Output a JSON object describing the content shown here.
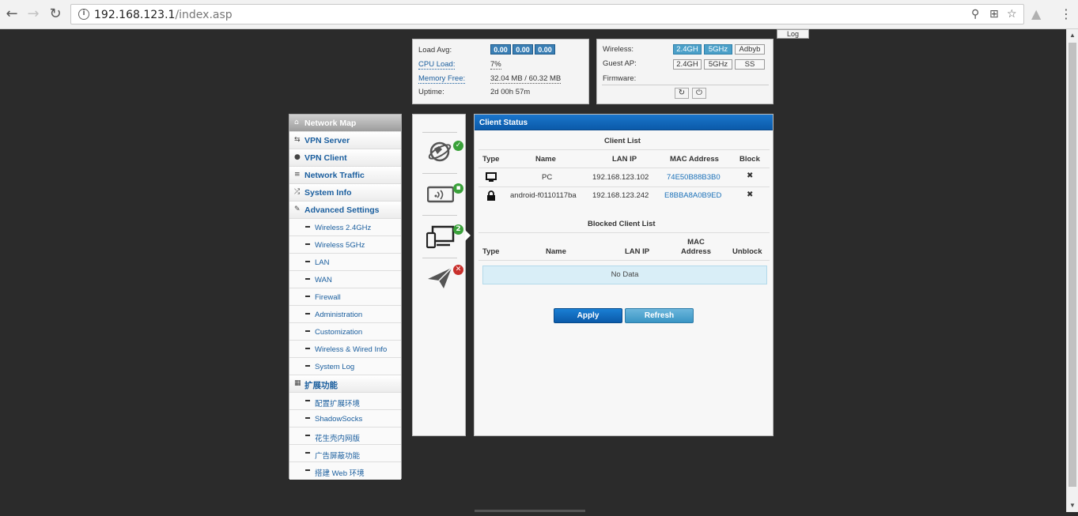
{
  "browser": {
    "url_host": "192.168.123.1",
    "url_path": "/index.asp"
  },
  "log_label": "Log",
  "status": {
    "load_avg_label": "Load Avg:",
    "load_values": [
      "0.00",
      "0.00",
      "0.00"
    ],
    "cpu_label": "CPU Load:",
    "cpu_value": "7%",
    "mem_label": "Memory Free:",
    "mem_value": "32.04 MB / 60.32 MB",
    "uptime_label": "Uptime:",
    "uptime_value": "2d 00h 57m"
  },
  "wireless": {
    "wireless_label": "Wireless:",
    "wireless_buttons": [
      "2.4GH",
      "5GHz",
      "Adbyb"
    ],
    "guest_label": "Guest AP:",
    "guest_buttons": [
      "2.4GH",
      "5GHz",
      "SS"
    ],
    "firmware_label": "Firmware:"
  },
  "menu": {
    "main": [
      {
        "label": "Network Map",
        "icon": "home-icon"
      },
      {
        "label": "VPN Server",
        "icon": "vpn-server-icon"
      },
      {
        "label": "VPN Client",
        "icon": "globe-icon"
      },
      {
        "label": "Network Traffic",
        "icon": "list-icon"
      },
      {
        "label": "System Info",
        "icon": "shuffle-icon"
      },
      {
        "label": "Advanced Settings",
        "icon": "wrench-icon"
      }
    ],
    "advanced": [
      "Wireless 2.4GHz",
      "Wireless 5GHz",
      "LAN",
      "WAN",
      "Firewall",
      "Administration",
      "Customization",
      "Wireless & Wired Info",
      "System Log"
    ],
    "ext_label": "扩展功能",
    "ext": [
      "配置扩展环境",
      "ShadowSocks",
      "花生壳内网版",
      "广告屏蔽功能",
      "搭建 Web 环境"
    ]
  },
  "map": {
    "client_count": "2"
  },
  "client_status": {
    "title": "Client Status",
    "client_list_title": "Client List",
    "headers": [
      "Type",
      "Name",
      "LAN IP",
      "MAC Address",
      "Block"
    ],
    "clients": [
      {
        "type_icon": "desktop-icon",
        "name": "PC",
        "ip": "192.168.123.102",
        "mac": "74E50B88B3B0",
        "block": "✖"
      },
      {
        "type_icon": "lock-icon",
        "name": "android-f0110117ba",
        "ip": "192.168.123.242",
        "mac": "E8BBA8A0B9ED",
        "block": "✖"
      }
    ],
    "blocked_title": "Blocked Client List",
    "blocked_headers": [
      "Type",
      "Name",
      "LAN IP",
      "MAC Address",
      "Unblock"
    ],
    "no_data": "No Data",
    "apply_label": "Apply",
    "refresh_label": "Refresh"
  }
}
